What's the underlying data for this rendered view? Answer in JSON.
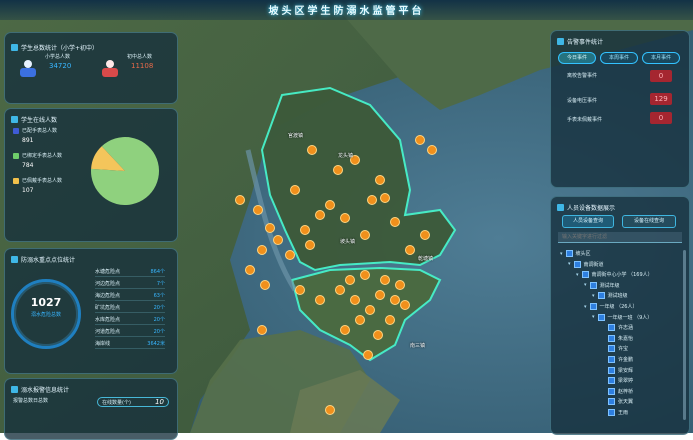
{
  "header": {
    "title": "坡头区学生防溺水监管平台"
  },
  "student_count": {
    "title": "学生总数统计（小学+初中）",
    "primary_label": "小学总人数",
    "primary_value": "34720",
    "middle_label": "初中总人数",
    "middle_value": "11108"
  },
  "stay_home": {
    "title": "学生在线人数",
    "items": [
      {
        "label": "已配手表总人数",
        "value": "891",
        "color": "#3f5bd6"
      },
      {
        "label": "已绑定手表总人数",
        "value": "784",
        "color": "#6fcd6a"
      },
      {
        "label": "已佩戴手表总人数",
        "value": "107",
        "color": "#f2c14b"
      }
    ]
  },
  "water_points": {
    "title": "防溺水重点点位统计",
    "total_value": "1027",
    "total_label": "溺水危险总数",
    "rows": [
      {
        "label": "水塘危险点",
        "value": "864个"
      },
      {
        "label": "河边危险点",
        "value": "7个"
      },
      {
        "label": "海边危险点",
        "value": "63个"
      },
      {
        "label": "矿坑危险点",
        "value": "20个"
      },
      {
        "label": "水库危险点",
        "value": "20个"
      },
      {
        "label": "河道危险点",
        "value": "20个"
      },
      {
        "label": "海岸线",
        "value": "3642米"
      }
    ]
  },
  "event_stats": {
    "title": "溺水报警信息统计",
    "label": "报警总数日总数",
    "select_label": "在线数量(个)",
    "select_value": "10"
  },
  "alarms": {
    "title": "告警事件统计",
    "tabs": [
      "今日事件",
      "本周事件",
      "本月事件"
    ],
    "events": [
      {
        "label": "离校告警事件",
        "value": "0"
      },
      {
        "label": "设备电压事件",
        "value": "129"
      },
      {
        "label": "手表未佩戴事件",
        "value": "0"
      }
    ]
  },
  "people_tree": {
    "title": "人员设备数据展示",
    "btn_person": "人员设备查询",
    "btn_device": "设备在线查询",
    "search_placeholder": "输入关键字进行过滤",
    "nodes": [
      {
        "label": "坡头区",
        "depth": 0
      },
      {
        "label": "南调街道",
        "depth": 1
      },
      {
        "label": "南调街中心小学 （169人）",
        "depth": 2
      },
      {
        "label": "测试年级",
        "depth": 3
      },
      {
        "label": "测试班级",
        "depth": 4
      },
      {
        "label": "一年级 （26人）",
        "depth": 3
      },
      {
        "label": "一年级一班 （9人）",
        "depth": 4
      },
      {
        "label": "许志涵",
        "depth": 5
      },
      {
        "label": "朱嘉怡",
        "depth": 5
      },
      {
        "label": "许宝",
        "depth": 5
      },
      {
        "label": "许金鹏",
        "depth": 5
      },
      {
        "label": "梁安辉",
        "depth": 5
      },
      {
        "label": "梁翠婷",
        "depth": 5
      },
      {
        "label": "赵梓桥",
        "depth": 5
      },
      {
        "label": "张天翼",
        "depth": 5
      },
      {
        "label": "王雨",
        "depth": 5
      }
    ]
  },
  "map": {
    "labels": [
      "龙头镇",
      "官渡镇",
      "坡头镇",
      "乾塘镇",
      "南三镇"
    ]
  },
  "colors": {
    "accent": "#38b6ff",
    "danger": "#a52630",
    "pie_green": "#8fd17e",
    "pie_yellow": "#f4c55b",
    "marker": "#f0901c"
  }
}
